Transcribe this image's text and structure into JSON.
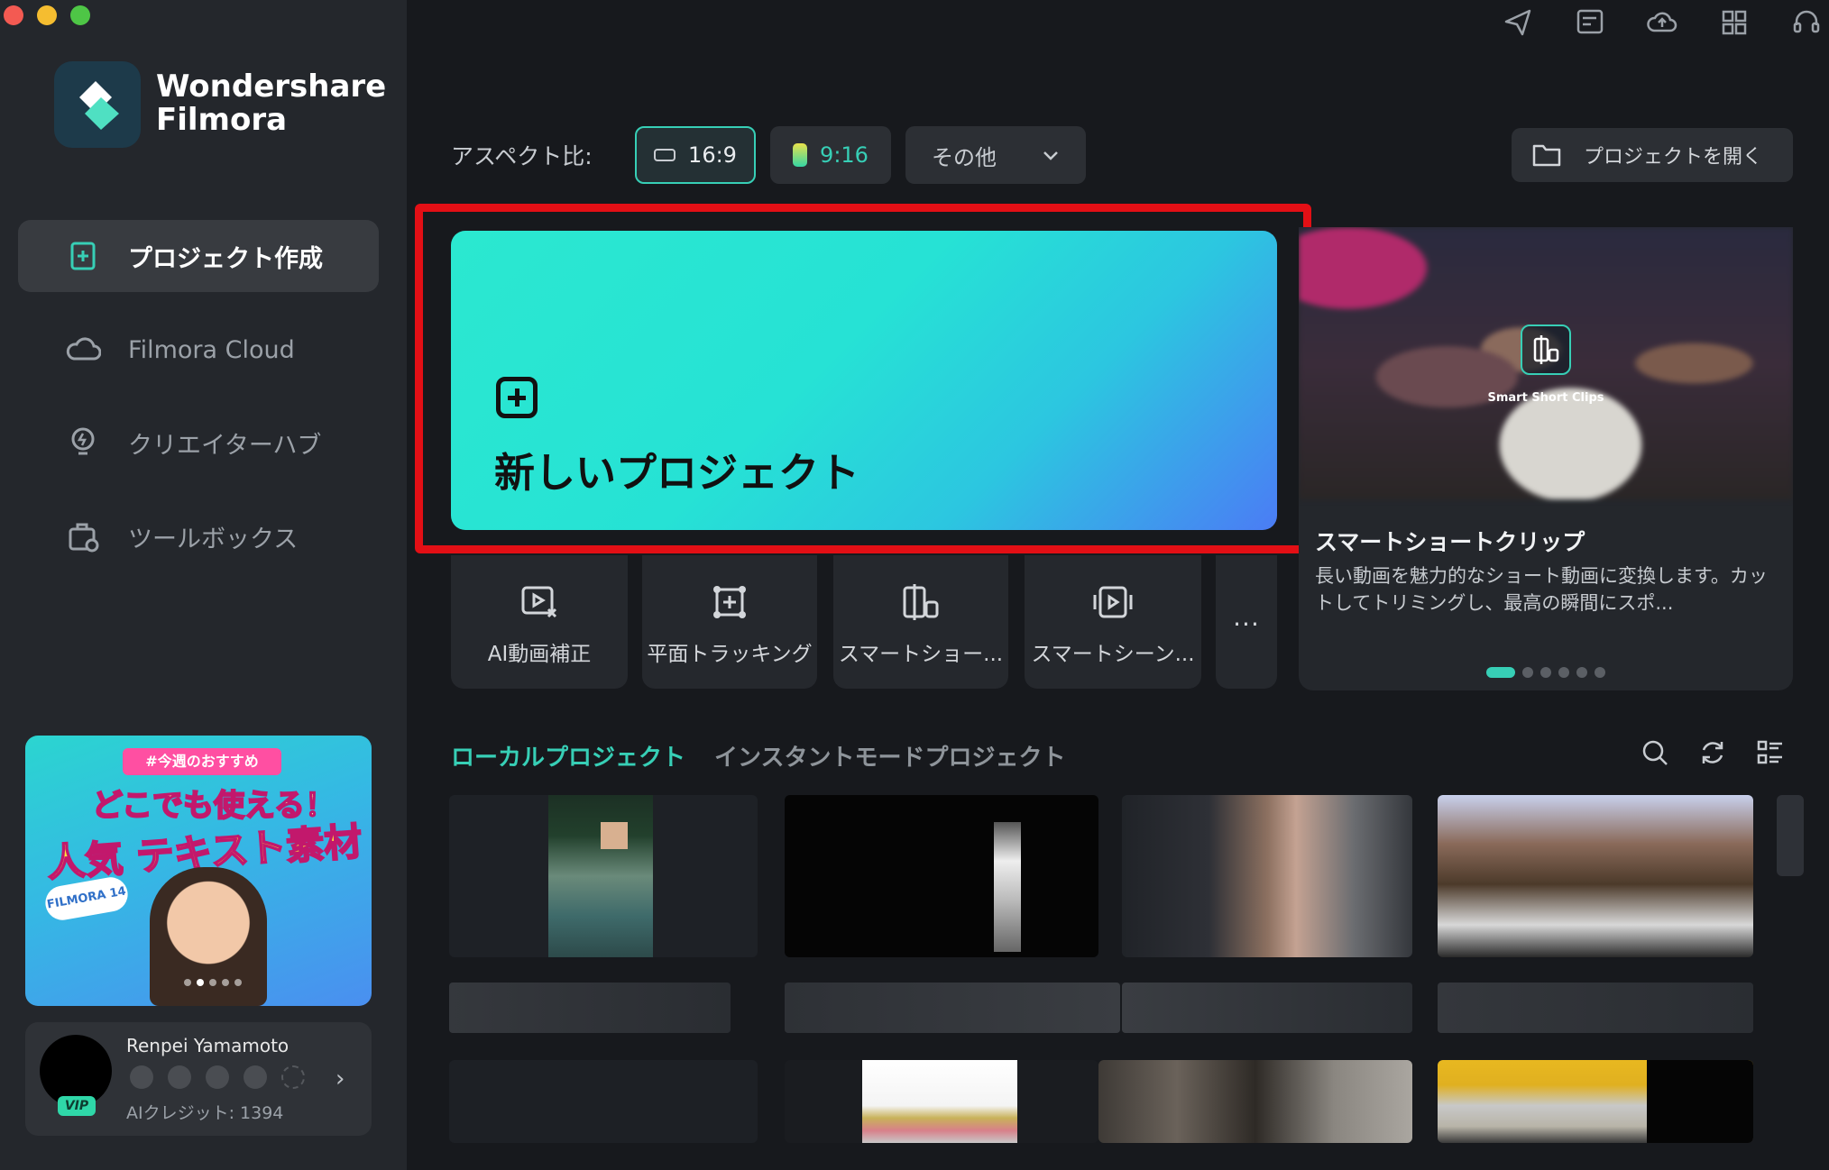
{
  "app": {
    "brand_line1": "Wondershare",
    "brand_line2": "Filmora"
  },
  "sidebar": {
    "items": [
      {
        "label": "プロジェクト作成",
        "icon": "new-project-icon",
        "active": true
      },
      {
        "label": "Filmora Cloud",
        "icon": "cloud-icon",
        "active": false
      },
      {
        "label": "クリエイターハブ",
        "icon": "lightbulb-icon",
        "active": false
      },
      {
        "label": "ツールボックス",
        "icon": "toolbox-icon",
        "active": false
      }
    ],
    "promo": {
      "tag": "#今週のおすすめ",
      "line1": "どこでも使える！",
      "line2": "人気 テキスト素材",
      "badge": "FILMORA 14"
    },
    "user": {
      "name": "Renpei Yamamoto",
      "vip": "VIP",
      "credits": "AIクレジット: 1394"
    }
  },
  "top_icons": [
    "send-icon",
    "task-list-icon",
    "cloud-upload-icon",
    "grid-apps-icon",
    "headset-support-icon"
  ],
  "aspect": {
    "label": "アスペクト比:",
    "options": [
      {
        "label": "16:9",
        "selected": true
      },
      {
        "label": "9:16",
        "selected": false
      },
      {
        "label": "その他",
        "selected": false
      }
    ],
    "open_project": "プロジェクトを開く"
  },
  "new_project": {
    "title": "新しいプロジェクト"
  },
  "tools": [
    {
      "label": "AI動画補正",
      "icon": "ai-video-enhance-icon"
    },
    {
      "label": "平面トラッキング",
      "icon": "planar-tracking-icon"
    },
    {
      "label": "スマートショー...",
      "icon": "smart-short-clips-icon"
    },
    {
      "label": "スマートシーン...",
      "icon": "smart-scene-icon"
    },
    {
      "label": "...",
      "icon": "more-icon"
    }
  ],
  "feature": {
    "caption": "Smart Short Clips",
    "title": "スマートショートクリップ",
    "description": "長い動画を魅力的なショート動画に変換します。カットしてトリミングし、最高の瞬間にスポ...",
    "slide_index": 1,
    "slide_count": 6
  },
  "projects": {
    "tabs": [
      {
        "label": "ローカルプロジェクト",
        "active": true
      },
      {
        "label": "インスタントモードプロジェクト",
        "active": false
      }
    ],
    "icons": [
      "search-icon",
      "refresh-icon",
      "list-view-icon"
    ]
  },
  "colors": {
    "accent": "#37cfb6",
    "highlight_border": "#e30f15",
    "sidebar_bg": "#24272c",
    "main_bg": "#17191d"
  }
}
